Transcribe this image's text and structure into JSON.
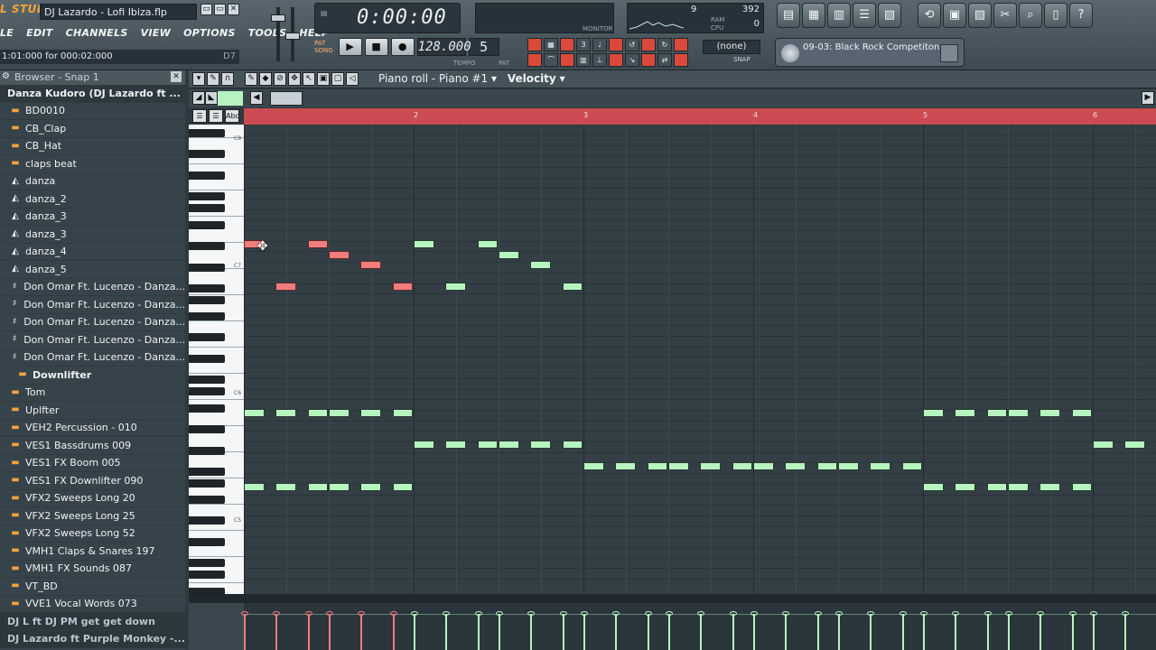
{
  "app": {
    "logo": "L STUDIO",
    "song_title": "DJ Lazardo - Lofi Ibiza.flp",
    "window_buttons": [
      "▭",
      "▭",
      "✕"
    ],
    "menu": [
      "LE",
      "EDIT",
      "CHANNELS",
      "VIEW",
      "OPTIONS",
      "TOOLS",
      "HELP"
    ],
    "hint": "1:01:000 for 000:02:000",
    "hint_key": "D7"
  },
  "transport": {
    "time": "0:00:00",
    "pattern_song": [
      "PAT",
      "SONG"
    ],
    "tempo": "128.000",
    "tempo_label": "TEMPO",
    "pattern": "5",
    "pattern_label": "PAT",
    "snap_value": "(none)",
    "snap_label": "SNAP",
    "monitor_label": "MONITOR"
  },
  "performance": {
    "polyphony": "9",
    "memory": "392",
    "cpu": "0",
    "labels": [
      "RAM",
      "CPU",
      "POLY"
    ]
  },
  "browser_preset": "09-03: Black Rock Competiton",
  "browser": {
    "header": "Browser - Snap 1",
    "root": "Danza Kudoro (DJ Lazardo ft ...",
    "items": [
      {
        "label": "BD0010",
        "icon": "folder-icon"
      },
      {
        "label": "CB_Clap",
        "icon": "folder-icon"
      },
      {
        "label": "CB_Hat",
        "icon": "folder-icon"
      },
      {
        "label": "claps beat",
        "icon": "folder-icon"
      },
      {
        "label": "danza",
        "icon": "audio-icon"
      },
      {
        "label": "danza_2",
        "icon": "audio-icon"
      },
      {
        "label": "danza_3",
        "icon": "audio-icon"
      },
      {
        "label": "danza_3",
        "icon": "audio-icon"
      },
      {
        "label": "danza_4",
        "icon": "audio-icon"
      },
      {
        "label": "danza_5",
        "icon": "audio-icon"
      },
      {
        "label": "Don Omar Ft. Lucenzo - Danza...",
        "icon": "plugin-icon"
      },
      {
        "label": "Don Omar Ft. Lucenzo - Danza...",
        "icon": "plugin-icon"
      },
      {
        "label": "Don Omar Ft. Lucenzo - Danza...",
        "icon": "plugin-icon"
      },
      {
        "label": "Don Omar Ft. Lucenzo - Danza...",
        "icon": "plugin-icon"
      },
      {
        "label": "Don Omar Ft. Lucenzo - Danza...",
        "icon": "plugin-icon"
      },
      {
        "label": "Downlifter",
        "icon": "folder-icon",
        "sub": true
      },
      {
        "label": "Tom",
        "icon": "folder-icon"
      },
      {
        "label": "Uplfter",
        "icon": "folder-icon"
      },
      {
        "label": "VEH2 Percussion - 010",
        "icon": "folder-icon"
      },
      {
        "label": "VES1 Bassdrums 009",
        "icon": "folder-icon"
      },
      {
        "label": "VES1 FX Boom 005",
        "icon": "folder-icon"
      },
      {
        "label": "VES1 FX Downlifter 090",
        "icon": "folder-icon"
      },
      {
        "label": "VFX2 Sweeps Long 20",
        "icon": "folder-icon"
      },
      {
        "label": "VFX2 Sweeps Long 25",
        "icon": "folder-icon"
      },
      {
        "label": "VFX2 Sweeps Long 52",
        "icon": "folder-icon"
      },
      {
        "label": "VMH1 Claps & Snares 197",
        "icon": "folder-icon"
      },
      {
        "label": "VMH1 FX Sounds 087",
        "icon": "folder-icon"
      },
      {
        "label": "VT_BD",
        "icon": "folder-icon"
      },
      {
        "label": "VVE1 Vocal Words 073",
        "icon": "folder-icon"
      }
    ],
    "footer_items": [
      "DJ L ft DJ PM get get down",
      "DJ Lazardo ft Purple Monkey -..."
    ]
  },
  "piano_roll": {
    "title": "Piano roll - Piano #1",
    "target": "Velocity",
    "bars": [
      "2",
      "3",
      "4",
      "5",
      "6"
    ],
    "key_labels": [
      "C8",
      "C7",
      "C6",
      "C5"
    ],
    "toolbar_icons": [
      "menu-icon",
      "pencil-icon",
      "brush-icon",
      "delete-icon",
      "mute-icon",
      "slice-icon",
      "select-icon",
      "zoom-icon",
      "play-icon"
    ],
    "ruler_buttons": [
      "☰",
      "☰",
      "Abc"
    ],
    "notes": [
      {
        "bar": 1.0,
        "row": 0,
        "len": 0.125,
        "red": true
      },
      {
        "bar": 1.375,
        "row": 0,
        "len": 0.125,
        "red": true
      },
      {
        "bar": 1.5,
        "row": 1,
        "len": 0.125,
        "red": true
      },
      {
        "bar": 1.6875,
        "row": 2,
        "len": 0.125,
        "red": true
      },
      {
        "bar": 1.1875,
        "row": 4,
        "len": 0.125,
        "red": true
      },
      {
        "bar": 1.875,
        "row": 4,
        "len": 0.125,
        "red": true
      },
      {
        "bar": 2.0,
        "row": 0,
        "len": 0.125
      },
      {
        "bar": 2.375,
        "row": 0,
        "len": 0.125
      },
      {
        "bar": 2.5,
        "row": 1,
        "len": 0.125
      },
      {
        "bar": 2.6875,
        "row": 2,
        "len": 0.125
      },
      {
        "bar": 2.1875,
        "row": 4,
        "len": 0.125
      },
      {
        "bar": 2.875,
        "row": 4,
        "len": 0.125
      },
      {
        "bar": 1.0,
        "row": 16,
        "len": 0.125
      },
      {
        "bar": 1.1875,
        "row": 16,
        "len": 0.125
      },
      {
        "bar": 1.375,
        "row": 16,
        "len": 0.125
      },
      {
        "bar": 1.5,
        "row": 16,
        "len": 0.125
      },
      {
        "bar": 1.6875,
        "row": 16,
        "len": 0.125
      },
      {
        "bar": 1.875,
        "row": 16,
        "len": 0.125
      },
      {
        "bar": 1.0,
        "row": 23,
        "len": 0.125
      },
      {
        "bar": 1.1875,
        "row": 23,
        "len": 0.125
      },
      {
        "bar": 1.375,
        "row": 23,
        "len": 0.125
      },
      {
        "bar": 1.5,
        "row": 23,
        "len": 0.125
      },
      {
        "bar": 1.6875,
        "row": 23,
        "len": 0.125
      },
      {
        "bar": 1.875,
        "row": 23,
        "len": 0.125
      },
      {
        "bar": 2.0,
        "row": 19,
        "len": 0.125
      },
      {
        "bar": 2.1875,
        "row": 19,
        "len": 0.125
      },
      {
        "bar": 2.375,
        "row": 19,
        "len": 0.125
      },
      {
        "bar": 2.5,
        "row": 19,
        "len": 0.125
      },
      {
        "bar": 2.6875,
        "row": 19,
        "len": 0.125
      },
      {
        "bar": 2.875,
        "row": 19,
        "len": 0.125
      },
      {
        "bar": 3.0,
        "row": 21,
        "len": 0.125
      },
      {
        "bar": 3.1875,
        "row": 21,
        "len": 0.125
      },
      {
        "bar": 3.375,
        "row": 21,
        "len": 0.125
      },
      {
        "bar": 3.5,
        "row": 21,
        "len": 0.125
      },
      {
        "bar": 3.6875,
        "row": 21,
        "len": 0.125
      },
      {
        "bar": 3.875,
        "row": 21,
        "len": 0.125
      },
      {
        "bar": 4.0,
        "row": 21,
        "len": 0.125
      },
      {
        "bar": 4.1875,
        "row": 21,
        "len": 0.125
      },
      {
        "bar": 4.375,
        "row": 21,
        "len": 0.125
      },
      {
        "bar": 4.5,
        "row": 21,
        "len": 0.125
      },
      {
        "bar": 4.6875,
        "row": 21,
        "len": 0.125
      },
      {
        "bar": 4.875,
        "row": 21,
        "len": 0.125
      },
      {
        "bar": 5.0,
        "row": 16,
        "len": 0.125
      },
      {
        "bar": 5.1875,
        "row": 16,
        "len": 0.125
      },
      {
        "bar": 5.375,
        "row": 16,
        "len": 0.125
      },
      {
        "bar": 5.5,
        "row": 16,
        "len": 0.125
      },
      {
        "bar": 5.6875,
        "row": 16,
        "len": 0.125
      },
      {
        "bar": 5.875,
        "row": 16,
        "len": 0.125
      },
      {
        "bar": 5.0,
        "row": 23,
        "len": 0.125
      },
      {
        "bar": 5.1875,
        "row": 23,
        "len": 0.125
      },
      {
        "bar": 5.375,
        "row": 23,
        "len": 0.125
      },
      {
        "bar": 5.5,
        "row": 23,
        "len": 0.125
      },
      {
        "bar": 5.6875,
        "row": 23,
        "len": 0.125
      },
      {
        "bar": 5.875,
        "row": 23,
        "len": 0.125
      },
      {
        "bar": 6.0,
        "row": 19,
        "len": 0.125
      },
      {
        "bar": 6.1875,
        "row": 19,
        "len": 0.125
      }
    ]
  },
  "colors": {
    "note": "#b6f4c0",
    "selected_note": "#f07c7c",
    "ruler": "#cc4b53",
    "grid": "#333e45"
  }
}
